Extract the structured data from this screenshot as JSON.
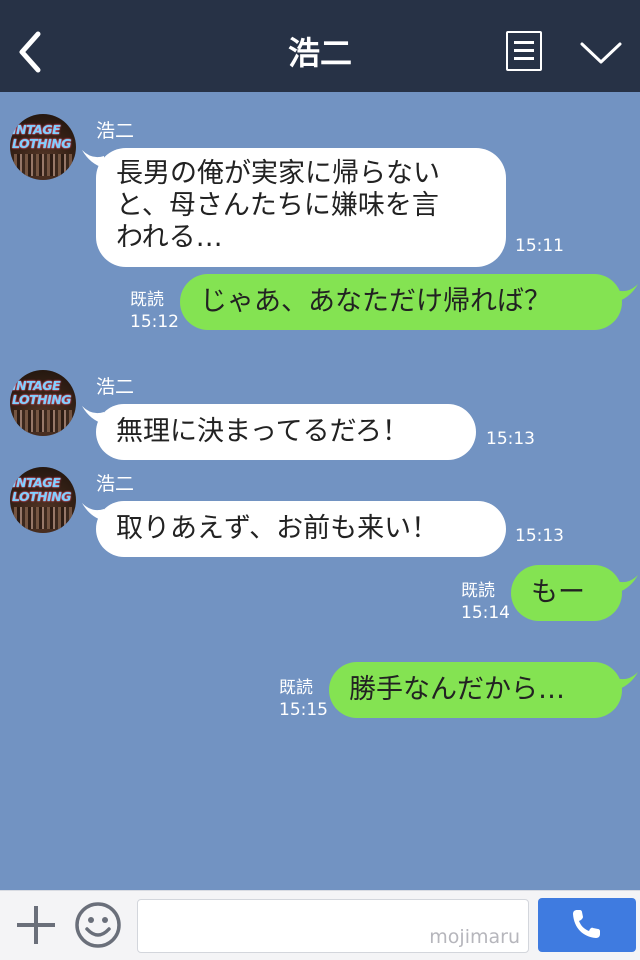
{
  "header": {
    "title": "浩二",
    "back_icon": "chevron-left-icon",
    "menu_icon": "menu-lines-icon",
    "collapse_icon": "chevron-down-icon",
    "bg_color": "#273246"
  },
  "chat": {
    "bg_color": "#7293c2",
    "avatar_text_line1": "INTAGE",
    "avatar_text_line2": "LOTHING",
    "messages": [
      {
        "side": "in",
        "sender": "浩二",
        "lines": [
          "長男の俺が実家に帰らない",
          "と、母さんたちに嫌味を言",
          "われる…"
        ],
        "time": "15:11"
      },
      {
        "side": "out",
        "text": "じゃあ、あなただけ帰れば？",
        "read": "既読",
        "time": "15:12"
      },
      {
        "side": "in",
        "sender": "浩二",
        "text": "無理に決まってるだろ！",
        "time": "15:13"
      },
      {
        "side": "in",
        "sender": "浩二",
        "text": "取りあえず、お前も来い！",
        "time": "15:13"
      },
      {
        "side": "out",
        "text": "もー",
        "read": "既読",
        "time": "15:14"
      },
      {
        "side": "out",
        "text": "勝手なんだから…",
        "read": "既読",
        "time": "15:15"
      }
    ]
  },
  "footer": {
    "plus_icon": "plus-icon",
    "sticker_icon": "smiley-icon",
    "input_value": "",
    "watermark": "mojimaru",
    "call_icon": "phone-icon",
    "call_color": "#3f7be0"
  }
}
